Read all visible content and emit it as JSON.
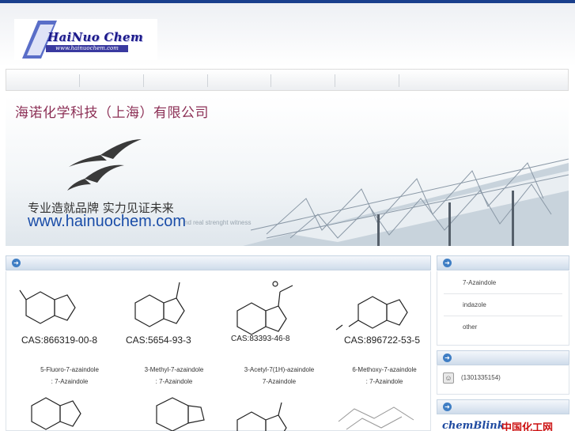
{
  "logo": {
    "name": "HaiNuo Chem",
    "url": "www.hainuochem.com"
  },
  "banner": {
    "title": "海诺化学科技（上海）有限公司",
    "slogan": "专业造就品牌  实力见证未来",
    "url": "www.hainuochem.com",
    "tagline": "nd real strenght witness"
  },
  "products": [
    {
      "cas": "CAS:866319-00-8",
      "name": "5-Fluoro-7-azaindole",
      "category": ": 7-Azaindole"
    },
    {
      "cas": "CAS:5654-93-3",
      "name": "3-Methyl-7-azaindole",
      "category": ": 7-Azaindole"
    },
    {
      "cas": "CAS:83393-46-8",
      "name": "3-Acetyl-7(1H)-azaindole",
      "category": "7-Azaindole"
    },
    {
      "cas": "CAS:896722-53-5",
      "name": "6-Methoxy-7-azaindole",
      "category": ": 7-Azaindole"
    }
  ],
  "sidebar": {
    "categories": [
      "7-Azaindole",
      "indazole",
      "other"
    ]
  },
  "contact": {
    "phone": "(1301335154)"
  },
  "links": {
    "link1": "chemBlink",
    "link2": "中国化工网"
  },
  "colors": {
    "accent": "#1a3f8c",
    "panel_bullet": "#3f7ec4",
    "title": "#8c2f55",
    "url": "#1a4da8"
  }
}
